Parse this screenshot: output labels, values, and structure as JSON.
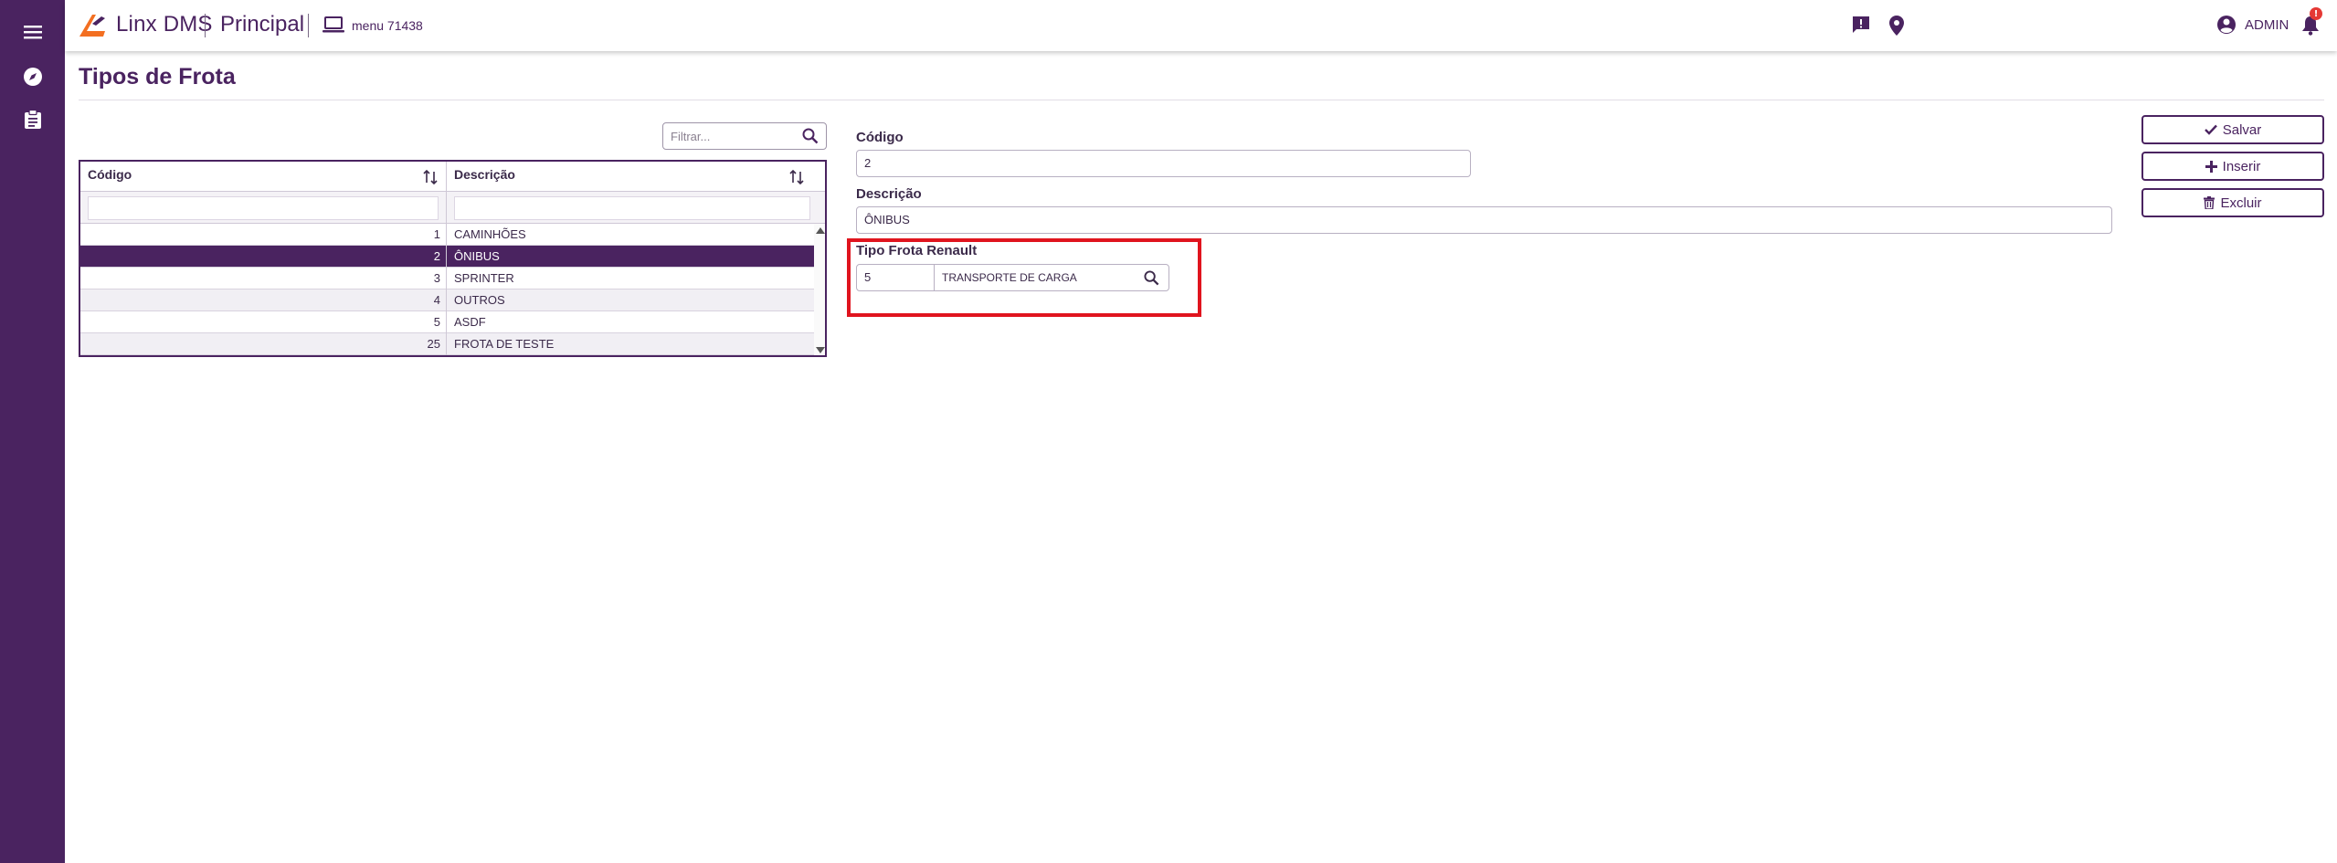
{
  "app": {
    "brand": "Linx DMS",
    "module": "Principal",
    "menu_code": "menu 71438"
  },
  "header": {
    "user": "ADMIN",
    "notifications_badge": "!"
  },
  "page": {
    "title": "Tipos de Frota"
  },
  "filter": {
    "placeholder": "Filtrar..."
  },
  "grid": {
    "columns": [
      "Código",
      "Descrição"
    ],
    "rows": [
      {
        "codigo": "1",
        "descricao": "CAMINHÕES"
      },
      {
        "codigo": "2",
        "descricao": "ÔNIBUS"
      },
      {
        "codigo": "3",
        "descricao": "SPRINTER"
      },
      {
        "codigo": "4",
        "descricao": "OUTROS"
      },
      {
        "codigo": "5",
        "descricao": "ASDF"
      },
      {
        "codigo": "25",
        "descricao": "FROTA DE TESTE"
      }
    ],
    "selected_index": 1
  },
  "form": {
    "codigo_label": "Código",
    "codigo_value": "2",
    "descricao_label": "Descrição",
    "descricao_value": "ÔNIBUS",
    "tipo_frota_label": "Tipo Frota Renault",
    "tipo_frota_code": "5",
    "tipo_frota_desc": "TRANSPORTE DE CARGA"
  },
  "actions": {
    "save": "Salvar",
    "insert": "Inserir",
    "delete": "Excluir"
  },
  "colors": {
    "primary": "#4a2360",
    "highlight": "#e0141e",
    "logo": "#f36f21"
  },
  "icons": [
    "menu-icon",
    "compass-icon",
    "clipboard-icon",
    "laptop-icon",
    "message-icon",
    "location-icon",
    "account-icon",
    "bell-icon",
    "search-icon",
    "sort-icon",
    "check-icon",
    "plus-icon",
    "trash-icon"
  ]
}
